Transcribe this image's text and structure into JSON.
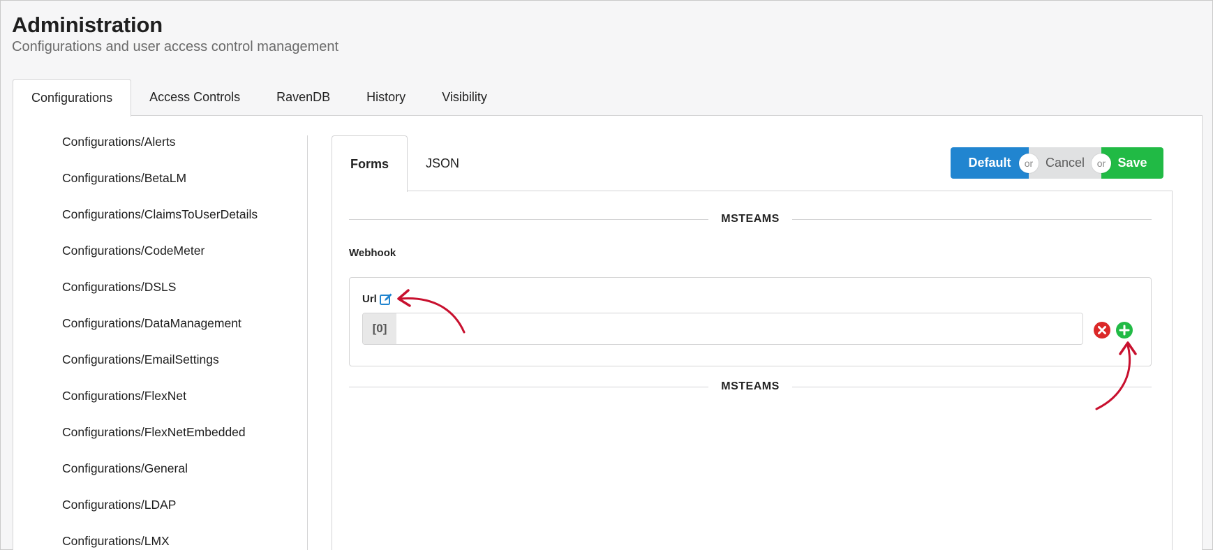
{
  "header": {
    "title": "Administration",
    "subtitle": "Configurations and user access control management"
  },
  "top_tabs": [
    {
      "label": "Configurations",
      "active": true
    },
    {
      "label": "Access Controls",
      "active": false
    },
    {
      "label": "RavenDB",
      "active": false
    },
    {
      "label": "History",
      "active": false
    },
    {
      "label": "Visibility",
      "active": false
    }
  ],
  "config_list": [
    "Configurations/Alerts",
    "Configurations/BetaLM",
    "Configurations/ClaimsToUserDetails",
    "Configurations/CodeMeter",
    "Configurations/DSLS",
    "Configurations/DataManagement",
    "Configurations/EmailSettings",
    "Configurations/FlexNet",
    "Configurations/FlexNetEmbedded",
    "Configurations/General",
    "Configurations/LDAP",
    "Configurations/LMX"
  ],
  "inner_tabs": [
    {
      "label": "Forms",
      "active": true
    },
    {
      "label": "JSON",
      "active": false
    }
  ],
  "actions": {
    "default_label": "Default",
    "cancel_label": "Cancel",
    "save_label": "Save",
    "or_label": "or"
  },
  "form": {
    "section_heading": "MSTEAMS",
    "section_footer": "MSTEAMS",
    "group_label": "Webhook",
    "field_label": "Url",
    "index_prefix": "[0]",
    "field_value": ""
  },
  "icons": {
    "edit": "edit-icon",
    "remove": "remove-icon",
    "add": "add-icon"
  },
  "colors": {
    "primary": "#2185d0",
    "save": "#21ba45",
    "remove": "#db2828",
    "annotation": "#c8102e"
  }
}
